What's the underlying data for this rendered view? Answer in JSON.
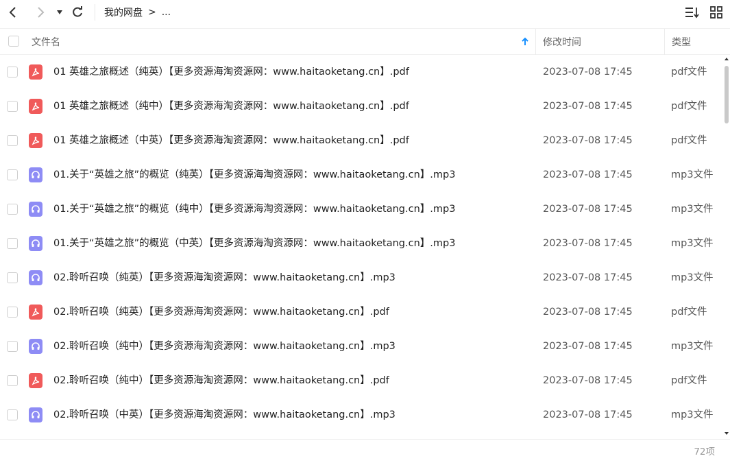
{
  "toolbar": {
    "back_icon": "chevron-left-icon",
    "forward_icon": "chevron-right-icon",
    "dropdown_icon": "caret-down-icon",
    "refresh_icon": "refresh-icon",
    "sort_icon": "sort-list-icon",
    "grid_icon": "grid-view-icon"
  },
  "breadcrumb": {
    "root": "我的网盘",
    "separator": ">",
    "more": "..."
  },
  "header": {
    "name": "文件名",
    "modified": "修改时间",
    "type": "类型",
    "sort_icon": "sort-asc-arrow-icon"
  },
  "files": [
    {
      "icon": "pdf",
      "name": "01 英雄之旅概述（纯英）【更多资源海淘资源网：www.haitaoketang.cn】.pdf",
      "time": "2023-07-08 17:45",
      "type": "pdf文件"
    },
    {
      "icon": "pdf",
      "name": "01 英雄之旅概述（纯中）【更多资源海淘资源网：www.haitaoketang.cn】.pdf",
      "time": "2023-07-08 17:45",
      "type": "pdf文件"
    },
    {
      "icon": "pdf",
      "name": "01 英雄之旅概述（中英）【更多资源海淘资源网：www.haitaoketang.cn】.pdf",
      "time": "2023-07-08 17:45",
      "type": "pdf文件"
    },
    {
      "icon": "mp3",
      "name": "01.关于“英雄之旅”的概览（纯英）【更多资源海淘资源网：www.haitaoketang.cn】.mp3",
      "time": "2023-07-08 17:45",
      "type": "mp3文件"
    },
    {
      "icon": "mp3",
      "name": "01.关于“英雄之旅”的概览（纯中）【更多资源海淘资源网：www.haitaoketang.cn】.mp3",
      "time": "2023-07-08 17:45",
      "type": "mp3文件"
    },
    {
      "icon": "mp3",
      "name": "01.关于“英雄之旅”的概览（中英）【更多资源海淘资源网：www.haitaoketang.cn】.mp3",
      "time": "2023-07-08 17:45",
      "type": "mp3文件"
    },
    {
      "icon": "mp3",
      "name": "02.聆听召唤（纯英）【更多资源海淘资源网：www.haitaoketang.cn】.mp3",
      "time": "2023-07-08 17:45",
      "type": "mp3文件"
    },
    {
      "icon": "pdf",
      "name": "02.聆听召唤（纯英）【更多资源海淘资源网：www.haitaoketang.cn】.pdf",
      "time": "2023-07-08 17:45",
      "type": "pdf文件"
    },
    {
      "icon": "mp3",
      "name": "02.聆听召唤（纯中）【更多资源海淘资源网：www.haitaoketang.cn】.mp3",
      "time": "2023-07-08 17:45",
      "type": "mp3文件"
    },
    {
      "icon": "pdf",
      "name": "02.聆听召唤（纯中）【更多资源海淘资源网：www.haitaoketang.cn】.pdf",
      "time": "2023-07-08 17:45",
      "type": "pdf文件"
    },
    {
      "icon": "mp3",
      "name": "02.聆听召唤（中英）【更多资源海淘资源网：www.haitaoketang.cn】.mp3",
      "time": "2023-07-08 17:45",
      "type": "mp3文件"
    }
  ],
  "footer": {
    "count": "72项"
  },
  "colors": {
    "pdf": "#f05a5a",
    "mp3": "#8e8cf5",
    "accent": "#1890ff"
  }
}
